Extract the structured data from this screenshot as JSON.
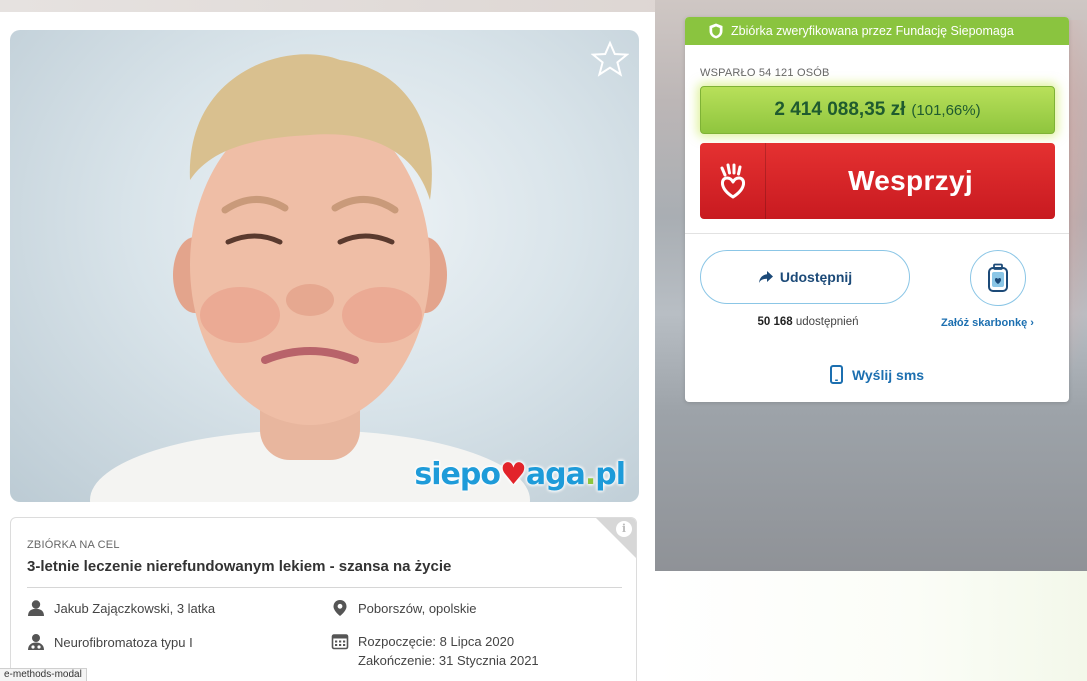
{
  "campaign": {
    "kicker": "ZBIÓRKA NA CEL",
    "title": "3-letnie leczenie nierefundowanym lekiem - szansa na życie",
    "beneficiary": "Jakub Zajączkowski, 3 latka",
    "diagnosis": "Neurofibromatoza typu I",
    "location": "Poborszów, opolskie",
    "start": "Rozpoczęcie: 8 Lipca 2020",
    "end": "Zakończenie: 31 Stycznia 2021",
    "info_icon": "i"
  },
  "watermark": {
    "part1": "siepo",
    "heart": "♥",
    "part2": "aga",
    "dot": ".",
    "part3": "pl"
  },
  "donation": {
    "verified_text": "Zbiórka zweryfikowana przez Fundację Siepomaga",
    "supporters": "WSPARŁO 54 121 OSÓB",
    "amount": "2 414 088,35 zł",
    "percent": "(101,66%)",
    "support_button": "Wesprzyj",
    "share_button": "Udostępnij",
    "share_count": "50 168",
    "share_count_suffix": " udostępnień",
    "piggy_link": "Załóż skarbonkę ›",
    "sms_link": "Wyślij sms"
  },
  "status_bar": {
    "text": "e-methods-modal"
  },
  "colors": {
    "brand_green": "#8ac43f",
    "support_red": "#d42127",
    "link_blue": "#1c6fb0",
    "watermark_blue": "#1e9bd9"
  },
  "icons": {
    "favourite": "star-outline-icon",
    "shield": "shield-icon",
    "hand_heart": "hand-heart-icon",
    "share": "share-arrow-icon",
    "piggy": "piggy-bank-icon",
    "phone": "phone-icon",
    "user": "user-icon",
    "doctor": "doctor-icon",
    "location": "location-pin-icon",
    "calendar": "calendar-icon",
    "info": "info-icon"
  }
}
